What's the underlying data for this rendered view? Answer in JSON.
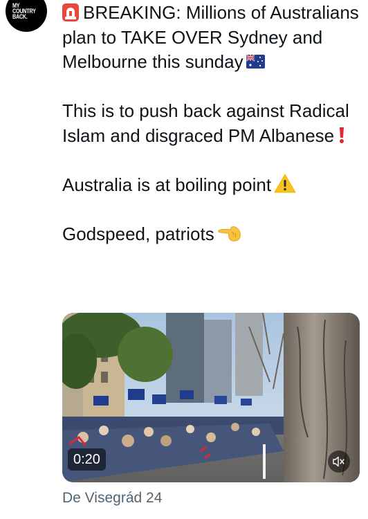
{
  "avatar": {
    "lines": [
      "MY",
      "COUNTRY",
      "BACK."
    ]
  },
  "tweet": {
    "paragraphs": [
      {
        "text": "BREAKING: Millions of Australians plan to TAKE OVER Sydney and Melbourne this sunday"
      },
      {
        "text": "This is to push back against Radical Islam and disgraced PM Albanese"
      },
      {
        "text": "Australia is at boiling point"
      },
      {
        "text": "Godspeed, patriots"
      }
    ],
    "emojis": {
      "siren": "police-car-light",
      "flag": "australia-flag",
      "exclamation": "red-exclamation-mark",
      "warning": "warning-sign",
      "hand": "backhand-pointing-left"
    }
  },
  "video": {
    "duration": "0:20",
    "muted_icon": "speaker-muted-icon"
  },
  "source": {
    "label": "De Visegrád 24"
  },
  "colors": {
    "text": "#0f1419",
    "secondary": "#536471",
    "background": "#ffffff"
  }
}
